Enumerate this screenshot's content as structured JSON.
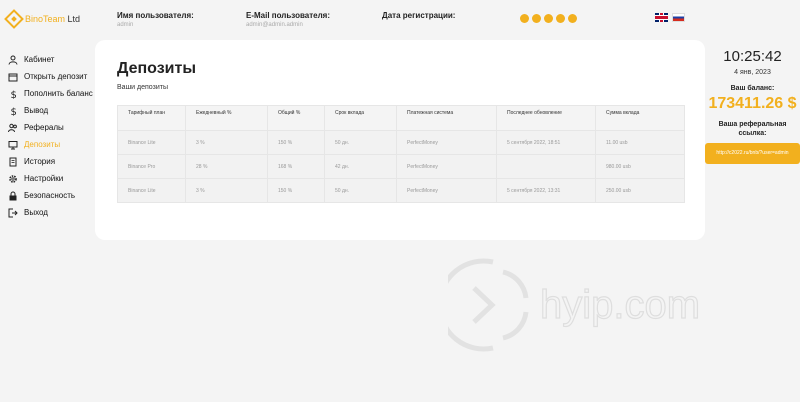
{
  "header": {
    "logo_text": "BinoTeam",
    "logo_suffix": "Ltd",
    "username_label": "Имя пользователя:",
    "username_value": "admin",
    "email_label": "E-Mail пользователя:",
    "email_value": "admin@admin.admin",
    "regdate_label": "Дата регистрации:",
    "regdate_value": ""
  },
  "sidebar": {
    "items": [
      {
        "label": "Кабинет",
        "icon": "user-icon"
      },
      {
        "label": "Открыть депозит",
        "icon": "wallet-icon"
      },
      {
        "label": "Пополнить баланс",
        "icon": "dollar-icon"
      },
      {
        "label": "Вывод",
        "icon": "dollar-icon"
      },
      {
        "label": "Рефералы",
        "icon": "users-icon"
      },
      {
        "label": "Депозиты",
        "icon": "monitor-icon"
      },
      {
        "label": "История",
        "icon": "document-icon"
      },
      {
        "label": "Настройки",
        "icon": "gear-icon"
      },
      {
        "label": "Безопасность",
        "icon": "lock-icon"
      },
      {
        "label": "Выход",
        "icon": "logout-icon"
      }
    ],
    "active": "Депозиты"
  },
  "main": {
    "title": "Депозиты",
    "subtitle": "Ваши депозиты",
    "columns": [
      "Тарифный план",
      "Ежедневный %",
      "Общий %",
      "Срок вклада",
      "Платежная система",
      "Последнее обновление",
      "Сумма вклада"
    ],
    "rows": [
      [
        "Binance Lite",
        "3 %",
        "150 %",
        "50 дн.",
        "PerfectMoney",
        "5 сентября 2022, 18:51",
        "11.00 usb"
      ],
      [
        "Binance Pro",
        "28 %",
        "168 %",
        "42 дн.",
        "PerfectMoney",
        "",
        "980.00 usb"
      ],
      [
        "Binance Lite",
        "3 %",
        "150 %",
        "50 дн.",
        "PerfectMoney",
        "5 сентября 2022, 13:31",
        "250.00 usb"
      ]
    ]
  },
  "right": {
    "time": "10:25:42",
    "date": "4 янв, 2023",
    "balance_label": "Ваш баланс:",
    "balance": "173411.26 $",
    "ref_label": "Ваша реферальная ссылка:",
    "ref_link": "http://c2022.ru/bnb/?user=admin"
  },
  "watermark": "hyip.com",
  "colors": {
    "accent": "#f2b01e"
  }
}
